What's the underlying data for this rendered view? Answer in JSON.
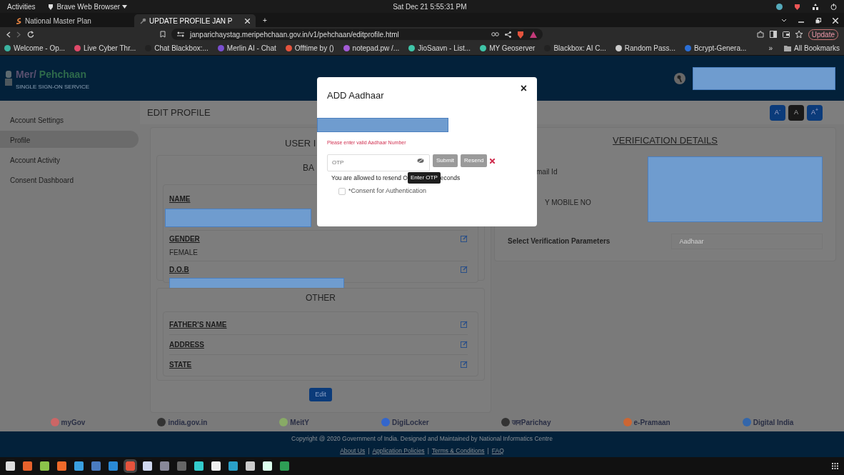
{
  "os_bar": {
    "activities": "Activities",
    "app_menu": "Brave Web Browser",
    "clock": "Sat Dec 21  5:55:31 PM"
  },
  "browser": {
    "tabs": [
      {
        "label": "National Master Plan",
        "selected": false
      },
      {
        "label": "UPDATE PROFILE JAN P",
        "selected": true
      }
    ],
    "new_tab": "+",
    "url": "janparichaystag.meripehchaan.gov.in/v1/pehchaan/editprofile.html",
    "update_button": "Update",
    "bookmarks": [
      "Welcome - Op...",
      "Live Cyber Thr...",
      "Chat Blackbox:...",
      "Merlin AI - Chat",
      "Offtime by ()",
      "notepad.pw /...",
      "JioSaavn - List...",
      "MY Geoserver",
      "Blackbox: AI C...",
      "Random Pass...",
      "Bcrypt-Genera..."
    ],
    "more_bookmarks": "»",
    "all_bookmarks": "All Bookmarks"
  },
  "header": {
    "logo_words": [
      "Mer/",
      "Pehchaan"
    ],
    "logo_subtitle": "SINGLE SIGN-ON SERVICE"
  },
  "sidebar": {
    "items": [
      {
        "label": "Account Settings",
        "selected": false
      },
      {
        "label": "Profile",
        "selected": true
      },
      {
        "label": "Account Activity",
        "selected": false
      },
      {
        "label": "Consent Dashboard",
        "selected": false
      }
    ]
  },
  "page": {
    "title": "EDIT PROFILE",
    "font_size_buttons": [
      {
        "label": "A$^{-}$",
        "selected": false
      },
      {
        "label": "A",
        "selected": true
      },
      {
        "label": "A$^{+}$",
        "selected": false
      }
    ]
  },
  "user_panel": {
    "heading": "USER I",
    "subheading": "BA",
    "basic_fields": [
      {
        "label": "NAME",
        "kind": "redacted",
        "edit_icon": false
      },
      {
        "label": "GENDER",
        "kind": "text",
        "value": "FEMALE",
        "edit_icon": true
      },
      {
        "label": "D.O.B",
        "kind": "redacted",
        "edit_icon": true
      }
    ],
    "other_heading": "OTHER",
    "other_fields": [
      {
        "label": "FATHER'S NAME"
      },
      {
        "label": "ADDRESS"
      },
      {
        "label": "STATE"
      }
    ],
    "edit_button": "Edit"
  },
  "verification_panel": {
    "heading": "VERIFICATION DETAILS",
    "rows": [
      "mail Id",
      "Y MOBILE NO"
    ],
    "parameter_label": "Select Verification Parameters",
    "parameter_value": "Aadhaar"
  },
  "modal": {
    "title": "ADD Aadhaar",
    "close": "×",
    "error": "Please enter valid Aadhaar Number",
    "otp_placeholder": "OTP",
    "submit_button": {
      "label": "Submit",
      "disabled": true
    },
    "resend_button": {
      "label": "Resend",
      "disabled": true
    },
    "note_before": "You are allowed to resend O",
    "tooltip": "Enter OTP",
    "note_after": "econds",
    "consent": {
      "label": "*Consent for Authentication",
      "checked": false
    }
  },
  "partner_logos": [
    "myGov",
    "india.gov.in",
    "MeitY",
    "DigiLocker",
    "जनParichay",
    "e-Pramaan",
    "Digital India"
  ],
  "footer": {
    "copyright": "Copyright @ 2020 Government of India. Designed and Maintained by National Informatics Centre",
    "links": [
      "About Us",
      "Application Policies",
      "Terms & Conditions",
      "FAQ"
    ],
    "separator": "|"
  }
}
